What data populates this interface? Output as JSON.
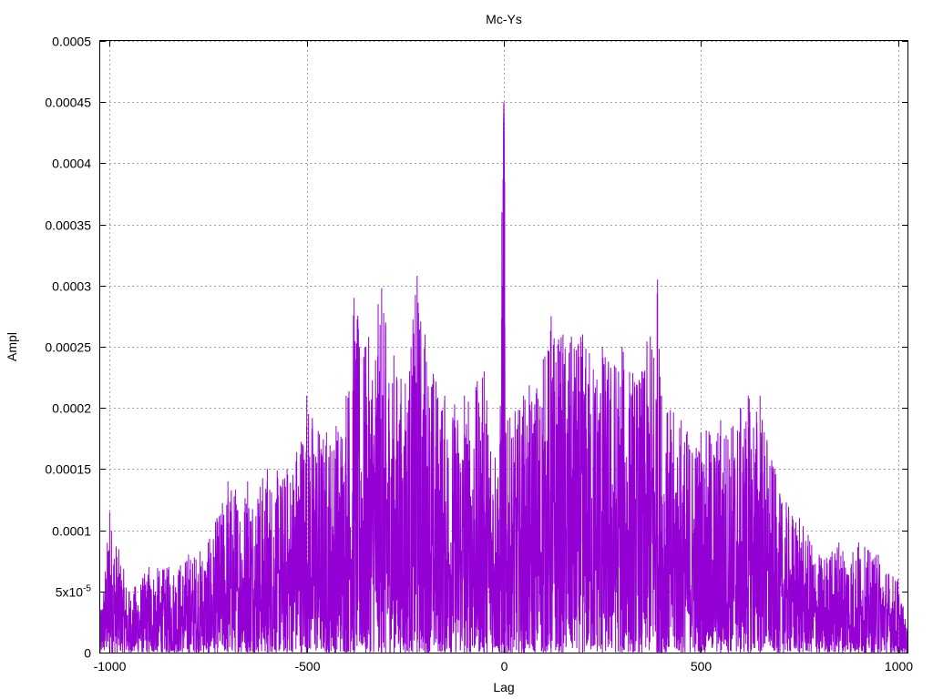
{
  "chart_data": {
    "type": "line",
    "title": "Mc-Ys",
    "xlabel": "Lag",
    "ylabel": "Ampl",
    "xlim": [
      -1024,
      1024
    ],
    "ylim": [
      0,
      0.0005
    ],
    "x_ticks": [
      {
        "value": -1000,
        "label": "-1000"
      },
      {
        "value": -500,
        "label": "-500"
      },
      {
        "value": 0,
        "label": "0"
      },
      {
        "value": 500,
        "label": "500"
      },
      {
        "value": 1000,
        "label": "1000"
      }
    ],
    "y_ticks": [
      {
        "value": 0,
        "label": "0"
      },
      {
        "value": 5e-05,
        "label": "5x10",
        "sup": "-5"
      },
      {
        "value": 0.0001,
        "label": "0.0001"
      },
      {
        "value": 0.00015,
        "label": "0.00015"
      },
      {
        "value": 0.0002,
        "label": "0.0002"
      },
      {
        "value": 0.00025,
        "label": "0.00025"
      },
      {
        "value": 0.0003,
        "label": "0.0003"
      },
      {
        "value": 0.00035,
        "label": "0.00035"
      },
      {
        "value": 0.0004,
        "label": "0.0004"
      },
      {
        "value": 0.00045,
        "label": "0.00045"
      },
      {
        "value": 0.0005,
        "label": "0.0005"
      }
    ],
    "grid": true,
    "legend": "none",
    "series": [
      {
        "color": "#9400d3",
        "x": [
          -1024,
          -1000,
          -950,
          -900,
          -850,
          -800,
          -750,
          -700,
          -650,
          -600,
          -550,
          -500,
          -450,
          -400,
          -380,
          -350,
          -310,
          -300,
          -250,
          -220,
          -200,
          -150,
          -100,
          -50,
          -10,
          -5,
          0,
          2,
          5,
          10,
          50,
          100,
          120,
          150,
          200,
          250,
          300,
          350,
          390,
          400,
          450,
          500,
          550,
          600,
          620,
          650,
          700,
          750,
          800,
          850,
          900,
          950,
          1000,
          1024
        ],
        "y": [
          3e-05,
          0.000115,
          5e-05,
          7e-05,
          7e-05,
          8e-05,
          9e-05,
          0.00014,
          0.00014,
          0.00015,
          0.00015,
          0.00021,
          0.00018,
          0.00021,
          0.00029,
          0.00025,
          0.000298,
          0.00027,
          0.00022,
          0.000308,
          0.00026,
          0.00021,
          0.00021,
          0.00023,
          0.00017,
          0.00036,
          0.00045,
          0.000385,
          0.00018,
          0.00019,
          0.00021,
          0.00024,
          0.000275,
          0.00026,
          0.00026,
          0.00025,
          0.00025,
          0.00023,
          0.000305,
          0.00021,
          0.00019,
          0.00018,
          0.00019,
          0.0002,
          0.00021,
          0.00021,
          0.00013,
          0.00011,
          8e-05,
          9e-05,
          9e-05,
          8e-05,
          6e-05,
          2e-05
        ]
      }
    ]
  }
}
